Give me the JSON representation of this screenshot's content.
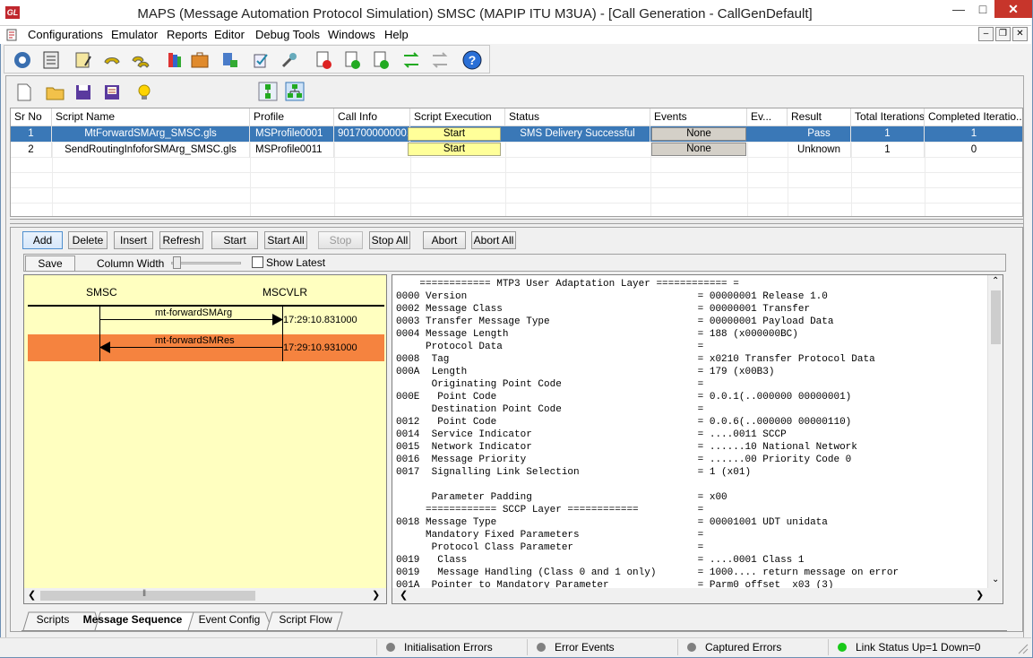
{
  "window": {
    "title": "MAPS (Message Automation Protocol Simulation) SMSC (MAPIP ITU M3UA) - [Call Generation  - CallGenDefault]",
    "app_icon_text": "GL"
  },
  "menu": [
    "Configurations",
    "Emulator",
    "Reports",
    "Editor",
    "Debug Tools",
    "Windows",
    "Help"
  ],
  "grid": {
    "columns": [
      "Sr No",
      "Script Name",
      "Profile",
      "Call Info",
      "Script Execution",
      "Status",
      "Events",
      "Ev...",
      "Result",
      "Total Iterations",
      "Completed Iteratio..."
    ],
    "rows": [
      {
        "sr": "1",
        "script": "MtForwardSMArg_SMSC.gls",
        "profile": "MSProfile0001",
        "callinfo": "901700000000...",
        "exec": "Start",
        "status": "SMS Delivery Successful",
        "events": "None",
        "ev": "",
        "result": "Pass",
        "total": "1",
        "completed": "1"
      },
      {
        "sr": "2",
        "script": "SendRoutingInfoforSMArg_SMSC.gls",
        "profile": "MSProfile0011",
        "callinfo": "",
        "exec": "Start",
        "status": "",
        "events": "None",
        "ev": "",
        "result": "Unknown",
        "total": "1",
        "completed": "0"
      }
    ]
  },
  "buttons": {
    "add": "Add",
    "delete": "Delete",
    "insert": "Insert",
    "refresh": "Refresh",
    "start": "Start",
    "start_all": "Start All",
    "stop": "Stop",
    "stop_all": "Stop All",
    "abort": "Abort",
    "abort_all": "Abort All"
  },
  "ladder": {
    "save": "Save",
    "column_width": "Column Width",
    "show_latest": "Show Latest",
    "left_node": "SMSC",
    "right_node": "MSCVLR",
    "messages": [
      {
        "label": "mt-forwardSMArg",
        "time": "17:29:10.831000",
        "direction": "right",
        "highlight": false
      },
      {
        "label": "mt-forwardSMRes",
        "time": "17:29:10.931000",
        "direction": "left",
        "highlight": true
      }
    ],
    "highlight_color": "#f5833f"
  },
  "decode_lines": [
    "    ============ MTP3 User Adaptation Layer ============ =",
    "0000 Version                                       = 00000001 Release 1.0",
    "0002 Message Class                                 = 00000001 Transfer",
    "0003 Transfer Message Type                         = 00000001 Payload Data",
    "0004 Message Length                                = 188 (x000000BC)",
    "     Protocol Data                                 =",
    "0008  Tag                                          = x0210 Transfer Protocol Data",
    "000A  Length                                       = 179 (x00B3)",
    "      Originating Point Code                       =",
    "000E   Point Code                                  = 0.0.1(..000000 00000001)",
    "      Destination Point Code                       =",
    "0012   Point Code                                  = 0.0.6(..000000 00000110)",
    "0014  Service Indicator                            = ....0011 SCCP",
    "0015  Network Indicator                            = ......10 National Network",
    "0016  Message Priority                             = ......00 Priority Code 0",
    "0017  Signalling Link Selection                    = 1 (x01)",
    "",
    "      Parameter Padding                            = x00",
    "     ============ SCCP Layer ============          =",
    "0018 Message Type                                  = 00001001 UDT unidata",
    "     Mandatory Fixed Parameters                    =",
    "      Protocol Class Parameter                     =",
    "0019   Class                                       = ....0001 Class 1",
    "0019   Message Handling (Class 0 and 1 only)       = 1000.... return message on error",
    "001A  Pointer to Mandatory Parameter               = Parm0 offset  x03 (3)"
  ],
  "tabs": [
    "Scripts",
    "Message Sequence",
    "Event Config",
    "Script Flow"
  ],
  "active_tab": "Message Sequence",
  "statusbar": [
    {
      "label": "Initialisation Errors",
      "color": "#808080"
    },
    {
      "label": "Error Events",
      "color": "#808080"
    },
    {
      "label": "Captured Errors",
      "color": "#808080"
    },
    {
      "label": "Link Status Up=1 Down=0",
      "color": "#19c919"
    }
  ]
}
